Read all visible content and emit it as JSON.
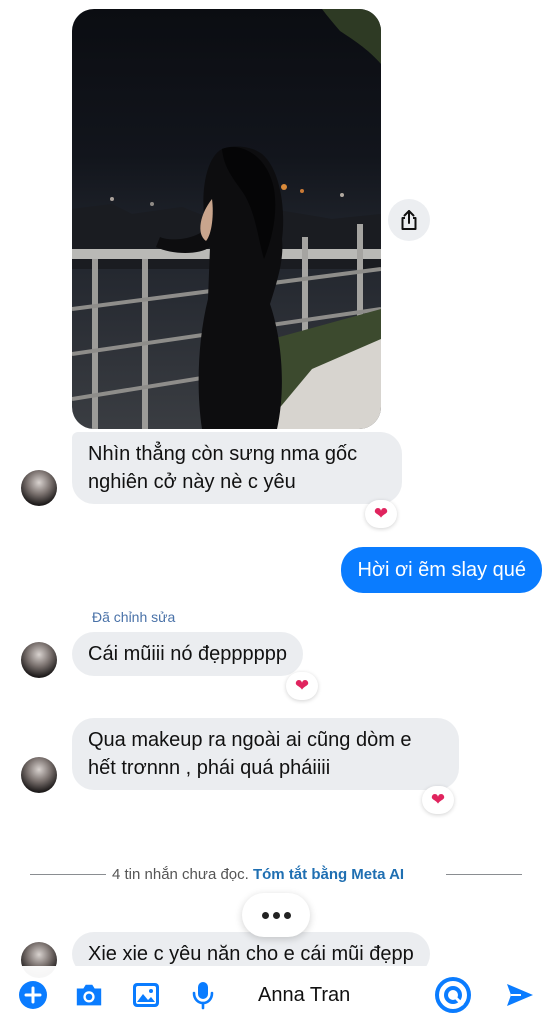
{
  "messages": {
    "m1_line1": "Nhìn thẳng còn sưng nma gốc",
    "m1_line2": "nghiên cở này nè c yêu",
    "m2": "Hời ơi ẽm slay qué",
    "edited_label": "Đã chỉnh sửa",
    "m3": "Cái mũiii nó đẹpppppp",
    "m4_line1": "Qua makeup ra ngoài ai cũng dòm e",
    "m4_line2": "hết trơnnn , phái quá pháiiii",
    "m5": "Xie xie c yêu năn cho e cái mũi đẹpp"
  },
  "reactions": {
    "heart": "❤"
  },
  "unread": {
    "text": "4 tin nhắn chưa đọc.",
    "link": "Tóm tắt bằng Meta AI"
  },
  "composer": {
    "recipient": "Anna Tran"
  },
  "icons": [
    "share-icon",
    "plus-icon",
    "camera-icon",
    "image-icon",
    "microphone-icon",
    "meta-ai-icon",
    "send-icon"
  ],
  "colors": {
    "outgoing_bubble": "#0a7cff",
    "incoming_bubble": "#ebedf0",
    "accent": "#0a7cff",
    "heart": "#e0245e",
    "link": "#1f6fb2"
  }
}
